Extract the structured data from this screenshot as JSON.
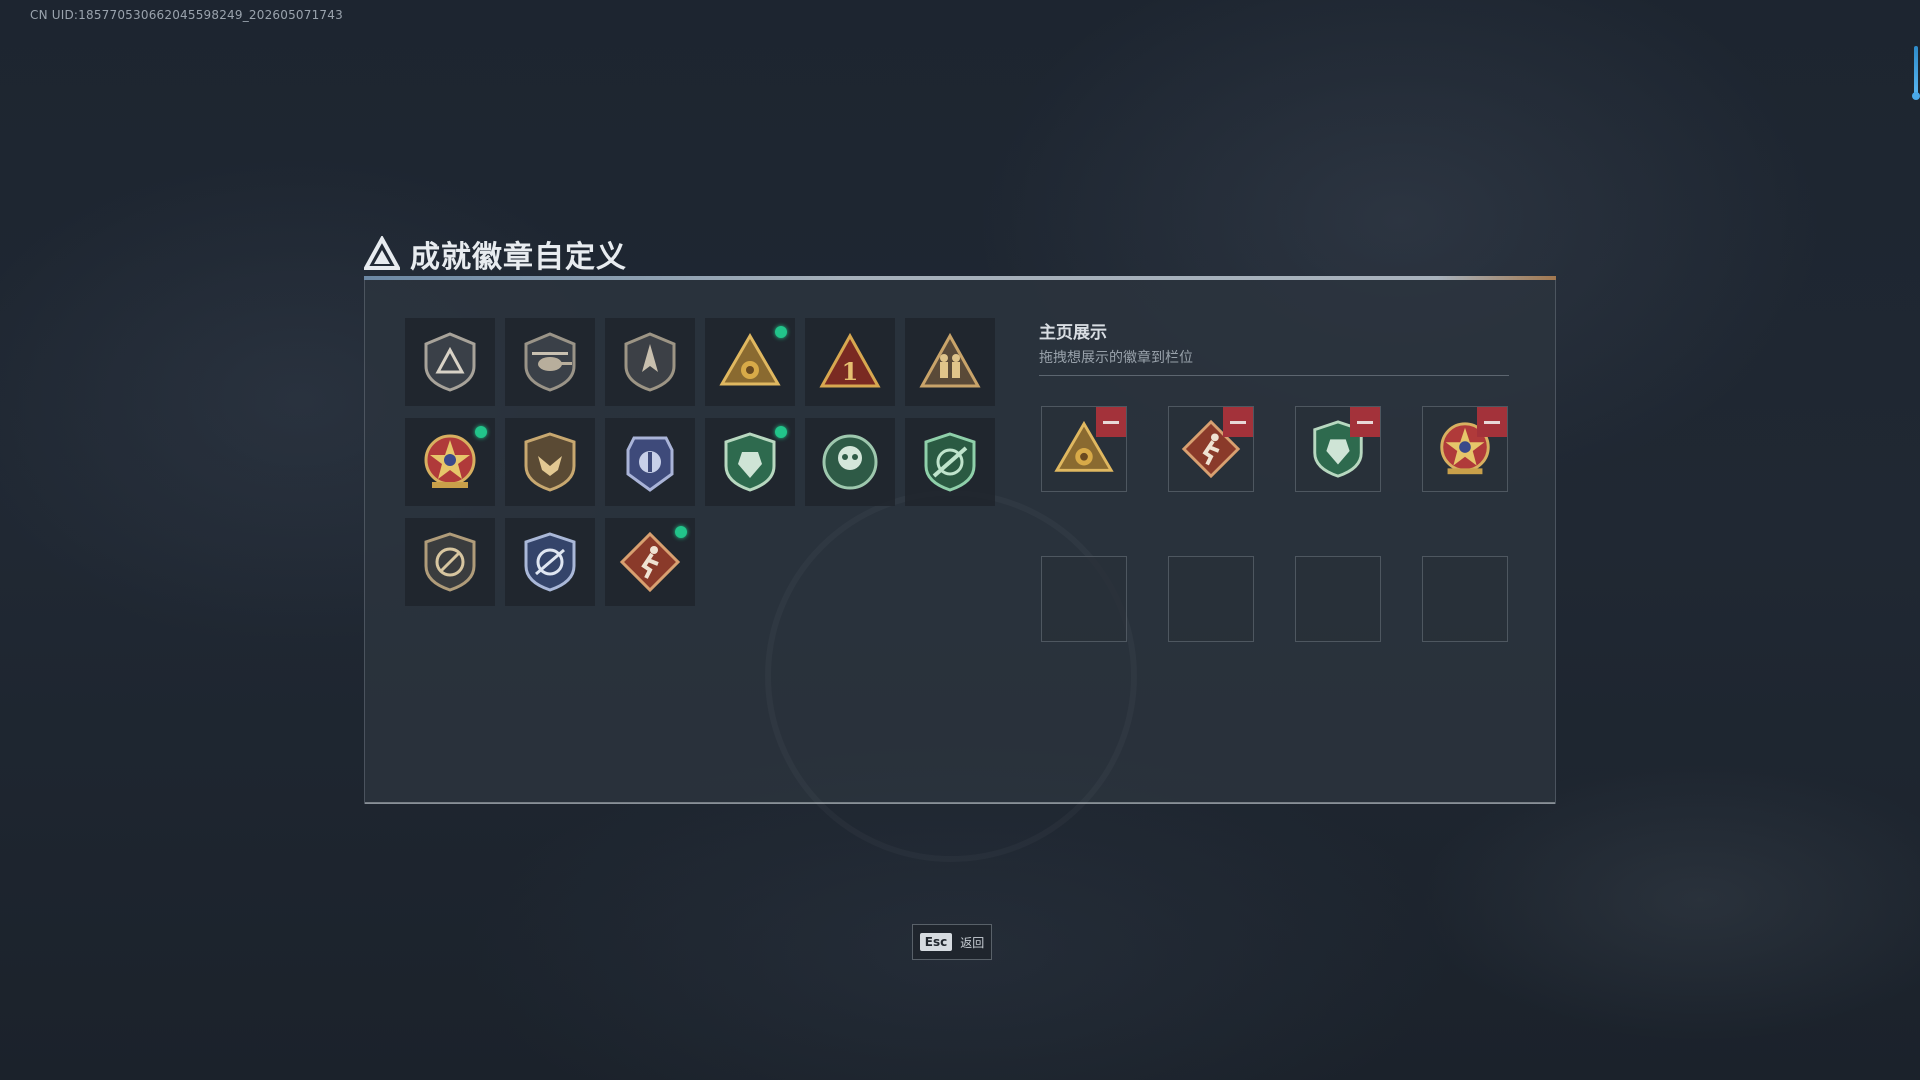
{
  "uid_text": "CN UID:185770530662045598249_202605071743",
  "page": {
    "title": "成就徽章自定义"
  },
  "badges": [
    {
      "icon": "triangle-shield-badge-icon",
      "selected": false
    },
    {
      "icon": "helicopter-badge-icon",
      "selected": false
    },
    {
      "icon": "arrow-shield-badge-icon",
      "selected": false
    },
    {
      "icon": "gold-pyramid-badge-icon",
      "selected": true
    },
    {
      "icon": "number-one-triangle-badge-icon",
      "selected": false
    },
    {
      "icon": "soldiers-triangle-badge-icon",
      "selected": false
    },
    {
      "icon": "star-wreath-badge-icon",
      "selected": true
    },
    {
      "icon": "eagle-shield-badge-icon",
      "selected": false
    },
    {
      "icon": "blue-emblem-badge-icon",
      "selected": false
    },
    {
      "icon": "green-shield-badge-icon",
      "selected": true
    },
    {
      "icon": "green-skull-badge-icon",
      "selected": false
    },
    {
      "icon": "green-rifle-shield-badge-icon",
      "selected": false
    },
    {
      "icon": "no-gun-shield-badge-icon",
      "selected": false
    },
    {
      "icon": "blue-crossed-badge-icon",
      "selected": false
    },
    {
      "icon": "runner-diamond-badge-icon",
      "selected": true
    }
  ],
  "showcase": {
    "title": "主页展示",
    "subtitle": "拖拽想展示的徽章到栏位",
    "slots": [
      {
        "icon": "gold-pyramid-badge-icon",
        "filled": true
      },
      {
        "icon": "runner-diamond-badge-icon",
        "filled": true
      },
      {
        "icon": "green-shield-badge-icon",
        "filled": true
      },
      {
        "icon": "star-wreath-badge-icon",
        "filled": true
      },
      {
        "filled": false
      },
      {
        "filled": false
      },
      {
        "filled": false
      },
      {
        "filled": false
      }
    ]
  },
  "footer": {
    "esc_key": "Esc",
    "back_label": "返回"
  }
}
